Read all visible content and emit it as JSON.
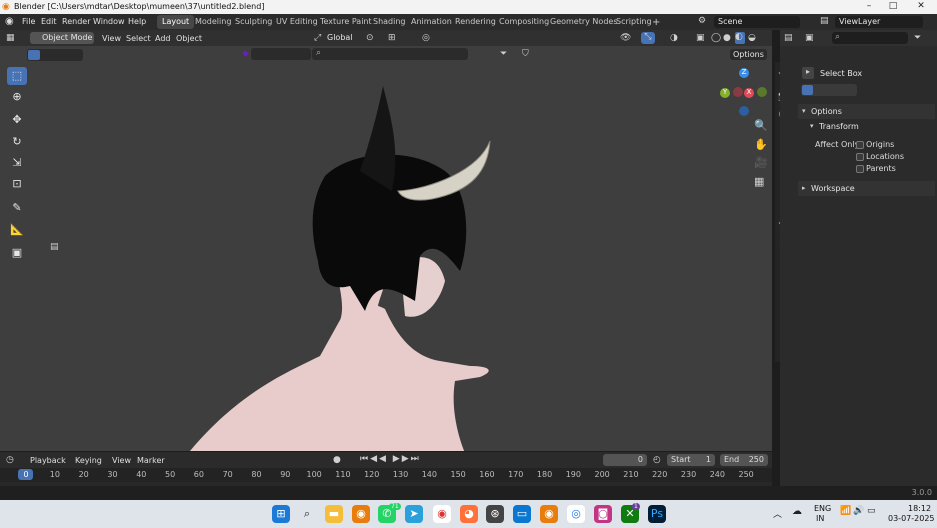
{
  "window": {
    "title": "Blender [C:\\Users\\mdtar\\Desktop\\mumeen\\37\\untitled2.blend]",
    "minimize": "–",
    "maximize": "□",
    "close": "✕"
  },
  "menus": [
    "File",
    "Edit",
    "Render",
    "Window",
    "Help"
  ],
  "workspaces": [
    "Layout",
    "Modeling",
    "Sculpting",
    "UV Editing",
    "Texture Paint",
    "Shading",
    "Animation",
    "Rendering",
    "Compositing",
    "Geometry Nodes",
    "Scripting"
  ],
  "add_workspace": "+",
  "scene": {
    "label": "Scene",
    "view_layer": "ViewLayer"
  },
  "viewport_header": {
    "mode": "Object Mode",
    "menus": [
      "View",
      "Select",
      "Add",
      "Object"
    ],
    "transform_orientation": "Global",
    "options": "Options"
  },
  "properties": {
    "tool_name": "Select Box",
    "options_panel": "Options",
    "transform_panel": "Transform",
    "affect_only": "Affect Only",
    "checkboxes": [
      "Origins",
      "Locations",
      "Parents"
    ],
    "workspace_panel": "Workspace"
  },
  "timeline": {
    "menus": [
      "Playback",
      "Keying",
      "View",
      "Marker"
    ],
    "current_frame": "0",
    "start_label": "Start",
    "start": "1",
    "end_label": "End",
    "end": "250",
    "ticks": [
      "0",
      "10",
      "20",
      "30",
      "40",
      "50",
      "60",
      "70",
      "80",
      "90",
      "100",
      "110",
      "120",
      "130",
      "140",
      "150",
      "160",
      "170",
      "180",
      "190",
      "200",
      "210",
      "220",
      "230",
      "240",
      "250"
    ]
  },
  "status": {
    "version": "3.0.0"
  },
  "taskbar": {
    "lang": "ENG",
    "region": "IN",
    "time": "18:12",
    "date": "03-07-2025",
    "badge_whatsapp": "71",
    "badge_xbox": "1"
  },
  "gizmo": {
    "z": "Z",
    "y": "Y",
    "x": "X"
  },
  "colors": {
    "accent": "#4772b3",
    "active_tool": "#4772b3",
    "x_axis": "#e04b5a",
    "y_axis": "#84b12e",
    "z_axis": "#3a8ee8"
  }
}
